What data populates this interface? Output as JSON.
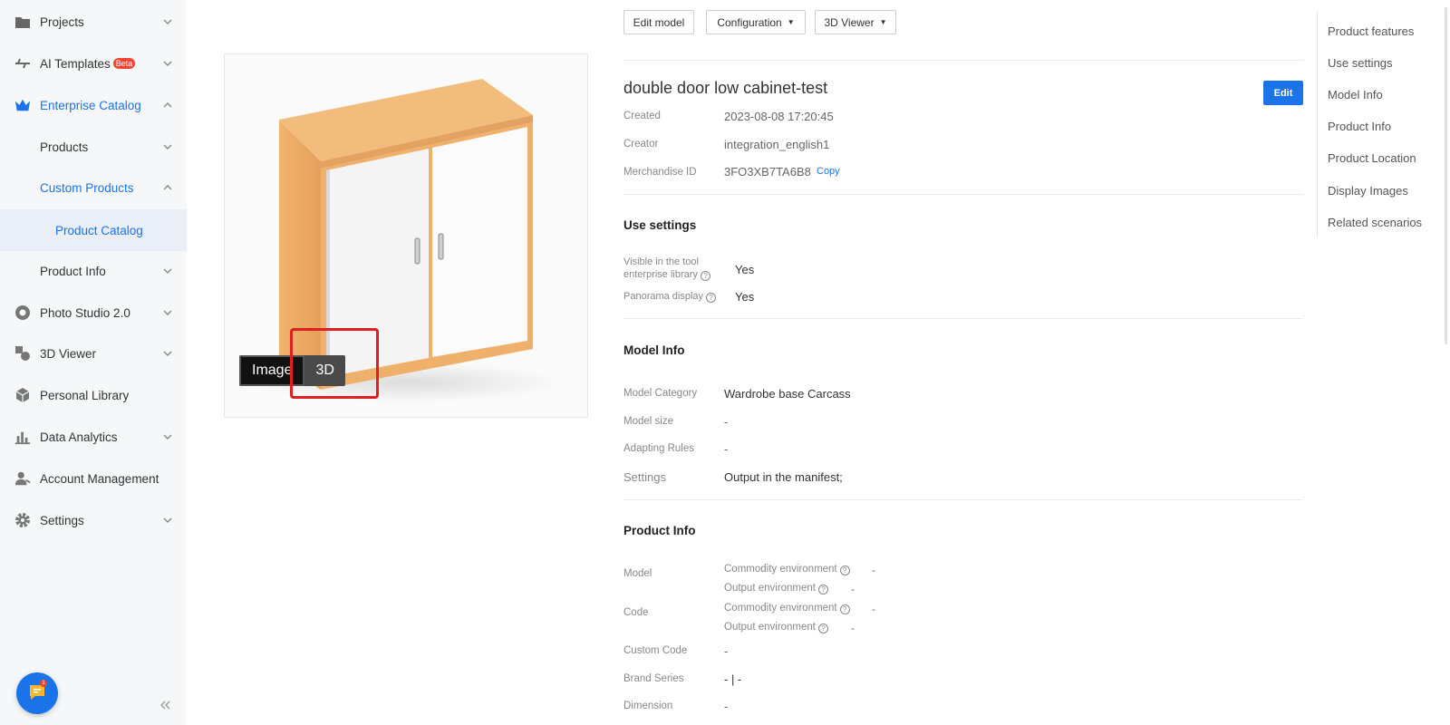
{
  "sidebar": {
    "items": [
      {
        "label": "Projects",
        "icon": "folder-icon"
      },
      {
        "label": "AI Templates",
        "badge": "Beta",
        "icon": "ai-templates-icon"
      },
      {
        "label": "Enterprise Catalog",
        "icon": "crown-icon"
      },
      {
        "label": "Products"
      },
      {
        "label": "Custom Products"
      },
      {
        "label": "Product Catalog"
      },
      {
        "label": "Product Info"
      },
      {
        "label": "Photo Studio 2.0",
        "icon": "photo-studio-icon"
      },
      {
        "label": "3D Viewer",
        "icon": "3d-viewer-icon"
      },
      {
        "label": "Personal Library",
        "icon": "cube-icon"
      },
      {
        "label": "Data Analytics",
        "icon": "bar-chart-icon"
      },
      {
        "label": "Account Management",
        "icon": "user-icon"
      },
      {
        "label": "Settings",
        "icon": "gear-icon"
      }
    ],
    "chat_badge": "1"
  },
  "toolbar": {
    "edit_model": "Edit model",
    "configuration": "Configuration",
    "viewer": "3D Viewer"
  },
  "preview": {
    "toggle_image": "Image",
    "toggle_3d": "3D"
  },
  "product": {
    "title": "double door low cabinet-test",
    "edit_label": "Edit",
    "created_label": "Created",
    "created_value": "2023-08-08 17:20:45",
    "creator_label": "Creator",
    "creator_value": "integration_english1",
    "merch_label": "Merchandise ID",
    "merch_value": "3FO3XB7TA6B8",
    "copy_label": "Copy"
  },
  "use_settings": {
    "heading": "Use settings",
    "visible_label_1": "Visible in the tool",
    "visible_label_2": "enterprise library",
    "visible_value": "Yes",
    "panorama_label": "Panorama display",
    "panorama_value": "Yes"
  },
  "model_info": {
    "heading": "Model Info",
    "category_label": "Model Category",
    "category_value": "Wardrobe base Carcass",
    "size_label": "Model size",
    "size_value": "-",
    "rules_label": "Adapting Rules",
    "rules_value": "-",
    "settings_label": "Settings",
    "settings_value": "Output in the manifest;"
  },
  "product_info": {
    "heading": "Product Info",
    "model_label": "Model",
    "code_label": "Code",
    "commodity_env": "Commodity environment",
    "output_env": "Output environment",
    "dash": "-",
    "custom_code_label": "Custom Code",
    "custom_code_value": "-",
    "brand_label": "Brand Series",
    "brand_value": "- | -",
    "dimension_label": "Dimension",
    "dimension_value": "-"
  },
  "anchors": [
    "Product features",
    "Use settings",
    "Model Info",
    "Product Info",
    "Product Location",
    "Display Images",
    "Related scenarios"
  ],
  "colors": {
    "accent": "#1a73e8",
    "badge": "#f5432f",
    "highlight": "#e02020"
  }
}
